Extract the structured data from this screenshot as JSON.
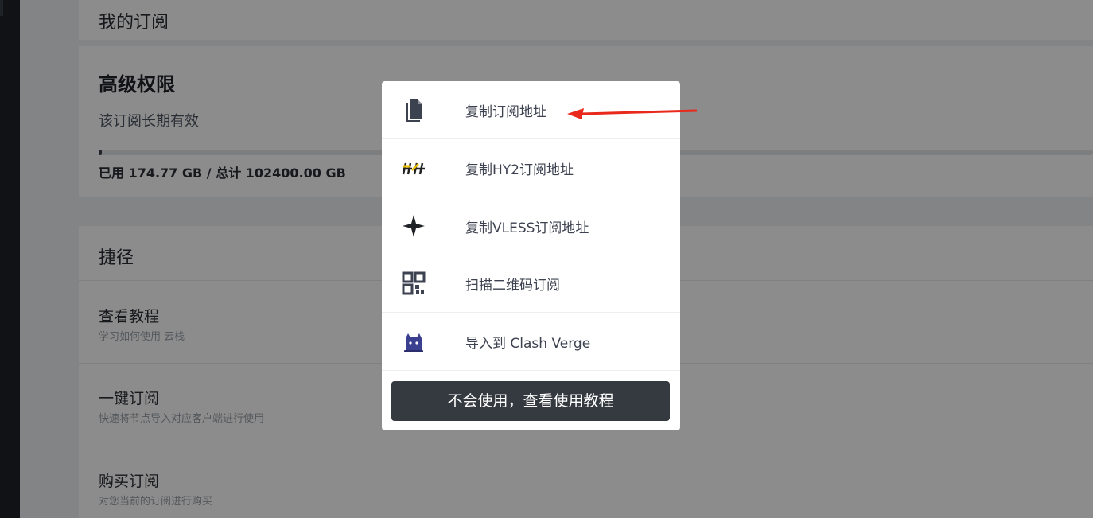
{
  "subscription": {
    "section_title": "我的订阅",
    "plan_name": "高级权限",
    "validity": "该订阅长期有效",
    "usage_text": "已用 174.77 GB / 总计 102400.00 GB",
    "usage_fraction": 0.0017
  },
  "shortcuts": {
    "section_title": "捷径",
    "items": [
      {
        "title": "查看教程",
        "desc": "学习如何使用 云栈"
      },
      {
        "title": "一键订阅",
        "desc": "快速将节点导入对应客户端进行使用"
      },
      {
        "title": "购买订阅",
        "desc": "对您当前的订阅进行购买"
      }
    ]
  },
  "modal": {
    "items": [
      {
        "label": "复制订阅地址",
        "icon": "copy-icon"
      },
      {
        "label": "复制HY2订阅地址",
        "icon": "hysteria2-icon"
      },
      {
        "label": "复制VLESS订阅地址",
        "icon": "vless-star-icon"
      },
      {
        "label": "扫描二维码订阅",
        "icon": "qr-code-icon"
      },
      {
        "label": "导入到 Clash Verge",
        "icon": "clash-cat-icon"
      }
    ],
    "cta_label": "不会使用，查看使用教程"
  },
  "colors": {
    "annotation_arrow": "#e8291c",
    "cta_background": "#343a40"
  }
}
